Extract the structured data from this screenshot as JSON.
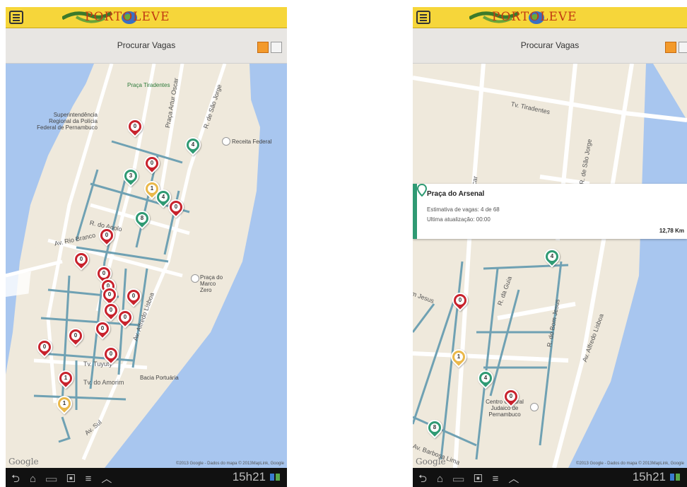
{
  "app": {
    "name": "PORTOLEVE",
    "screen_title": "Procurar Vagas",
    "icons": [
      "menu-icon",
      "map-view-icon",
      "list-view-icon"
    ],
    "accent": "#f6d63a",
    "pin_colors": {
      "red": "#c8222c",
      "green": "#2f9a73",
      "yellow": "#eab84a"
    }
  },
  "left_map": {
    "labels": {
      "praca_tiradentes": "Praça Tiradentes",
      "superintendencia": "Superintendência Regional da Polícia Federal de Pernambuco",
      "receita": "Receita Federal",
      "marco_zero": "Praça do Marco Zero",
      "bacia": "Bacia Portuária",
      "av_rio_branco": "Av. Rio Branco",
      "rua_apolo": "R. do Apolo",
      "tv_tuyuty": "Tv. Tuyuty",
      "tv_amorim": "Tv. do Amorim",
      "av_sul": "Av. Sul",
      "r_sao_jorge": "R. de São Jorge",
      "praca_artur": "Praça Artur Oscar",
      "av_alfredo": "Av. Alfredo Lisboa"
    },
    "pins": [
      {
        "color": "red",
        "count": "0"
      },
      {
        "color": "green",
        "count": "4"
      },
      {
        "color": "red",
        "count": "0"
      },
      {
        "color": "green",
        "count": "3"
      },
      {
        "color": "yellow",
        "count": "1"
      },
      {
        "color": "green",
        "count": "4"
      },
      {
        "color": "red",
        "count": "0"
      },
      {
        "color": "green",
        "count": "8"
      },
      {
        "color": "red",
        "count": "0"
      },
      {
        "color": "red",
        "count": "0"
      },
      {
        "color": "red",
        "count": "0"
      },
      {
        "color": "red",
        "count": "0"
      },
      {
        "color": "red",
        "count": "0"
      },
      {
        "color": "red",
        "count": "0"
      },
      {
        "color": "red",
        "count": "0"
      },
      {
        "color": "red",
        "count": "0"
      },
      {
        "color": "red",
        "count": "0"
      },
      {
        "color": "red",
        "count": "0"
      },
      {
        "color": "red",
        "count": "0"
      },
      {
        "color": "red",
        "count": "0"
      },
      {
        "color": "yellow",
        "count": "1"
      }
    ],
    "google": "Google",
    "copyright": "©2013 Google - Dados do mapa © 2013MapLink, Google"
  },
  "right_map": {
    "labels": {
      "tv_tiradentes": "Tv. Tiradentes",
      "r_sao_jorge": "R. de São Jorge",
      "r_da_guia": "R. da Guia",
      "r_bom_jesus": "R. do Bom Jesus",
      "av_alfredo": "Av. Alfredo Lisboa",
      "centro": "Centro Cultural Judaico de Pernambuco",
      "av_barbosa": "Av. Barbosa Lima",
      "oscar": "oscar",
      "m_jesus": "m Jesus"
    },
    "pins": [
      {
        "color": "green",
        "count": "4"
      },
      {
        "color": "red",
        "count": "0"
      },
      {
        "color": "yellow",
        "count": "1"
      },
      {
        "color": "green",
        "count": "4"
      },
      {
        "color": "red",
        "count": "0"
      },
      {
        "color": "green",
        "count": "8"
      }
    ],
    "info_card": {
      "title": "Praça do Arsenal",
      "estimate": "Estimativa de vagas: 4 de 68",
      "updated": "Ultima atualização: 00:00",
      "distance": "12,78 Km"
    },
    "google": "Google",
    "copyright": "©2013 Google - Dados do mapa © 2013MapLink, Google"
  },
  "status": {
    "time_left": "15h21",
    "time_right": "15h21"
  }
}
